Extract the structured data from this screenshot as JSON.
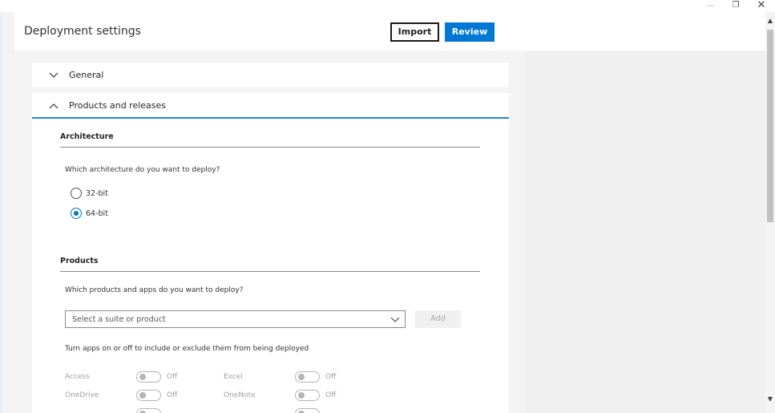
{
  "window": {
    "minimize_glyph": "—",
    "maximize_glyph": "❐",
    "close_glyph": "✕"
  },
  "header": {
    "title": "Deployment settings",
    "import_label": "Import",
    "review_label": "Review"
  },
  "sections": {
    "general": {
      "label": "General",
      "expanded": false
    },
    "products_releases": {
      "label": "Products and releases",
      "expanded": true
    }
  },
  "architecture": {
    "heading": "Architecture",
    "question": "Which architecture do you want to deploy?",
    "options": [
      {
        "label": "32-bit",
        "selected": false
      },
      {
        "label": "64-bit",
        "selected": true
      }
    ]
  },
  "products": {
    "heading": "Products",
    "question": "Which products and apps do you want to deploy?",
    "select_placeholder": "Select a suite or product",
    "add_label": "Add",
    "apps_instruction": "Turn apps on or off to include or exclude them from being deployed",
    "apps": [
      {
        "name": "Access",
        "state": "Off"
      },
      {
        "name": "Excel",
        "state": "Off"
      },
      {
        "name": "OneDrive",
        "state": "Off"
      },
      {
        "name": "OneNote",
        "state": "Off"
      }
    ]
  },
  "colors": {
    "accent": "#0078d4",
    "panel": "#f0f0f0",
    "disabled_text": "#a0a0a0"
  }
}
